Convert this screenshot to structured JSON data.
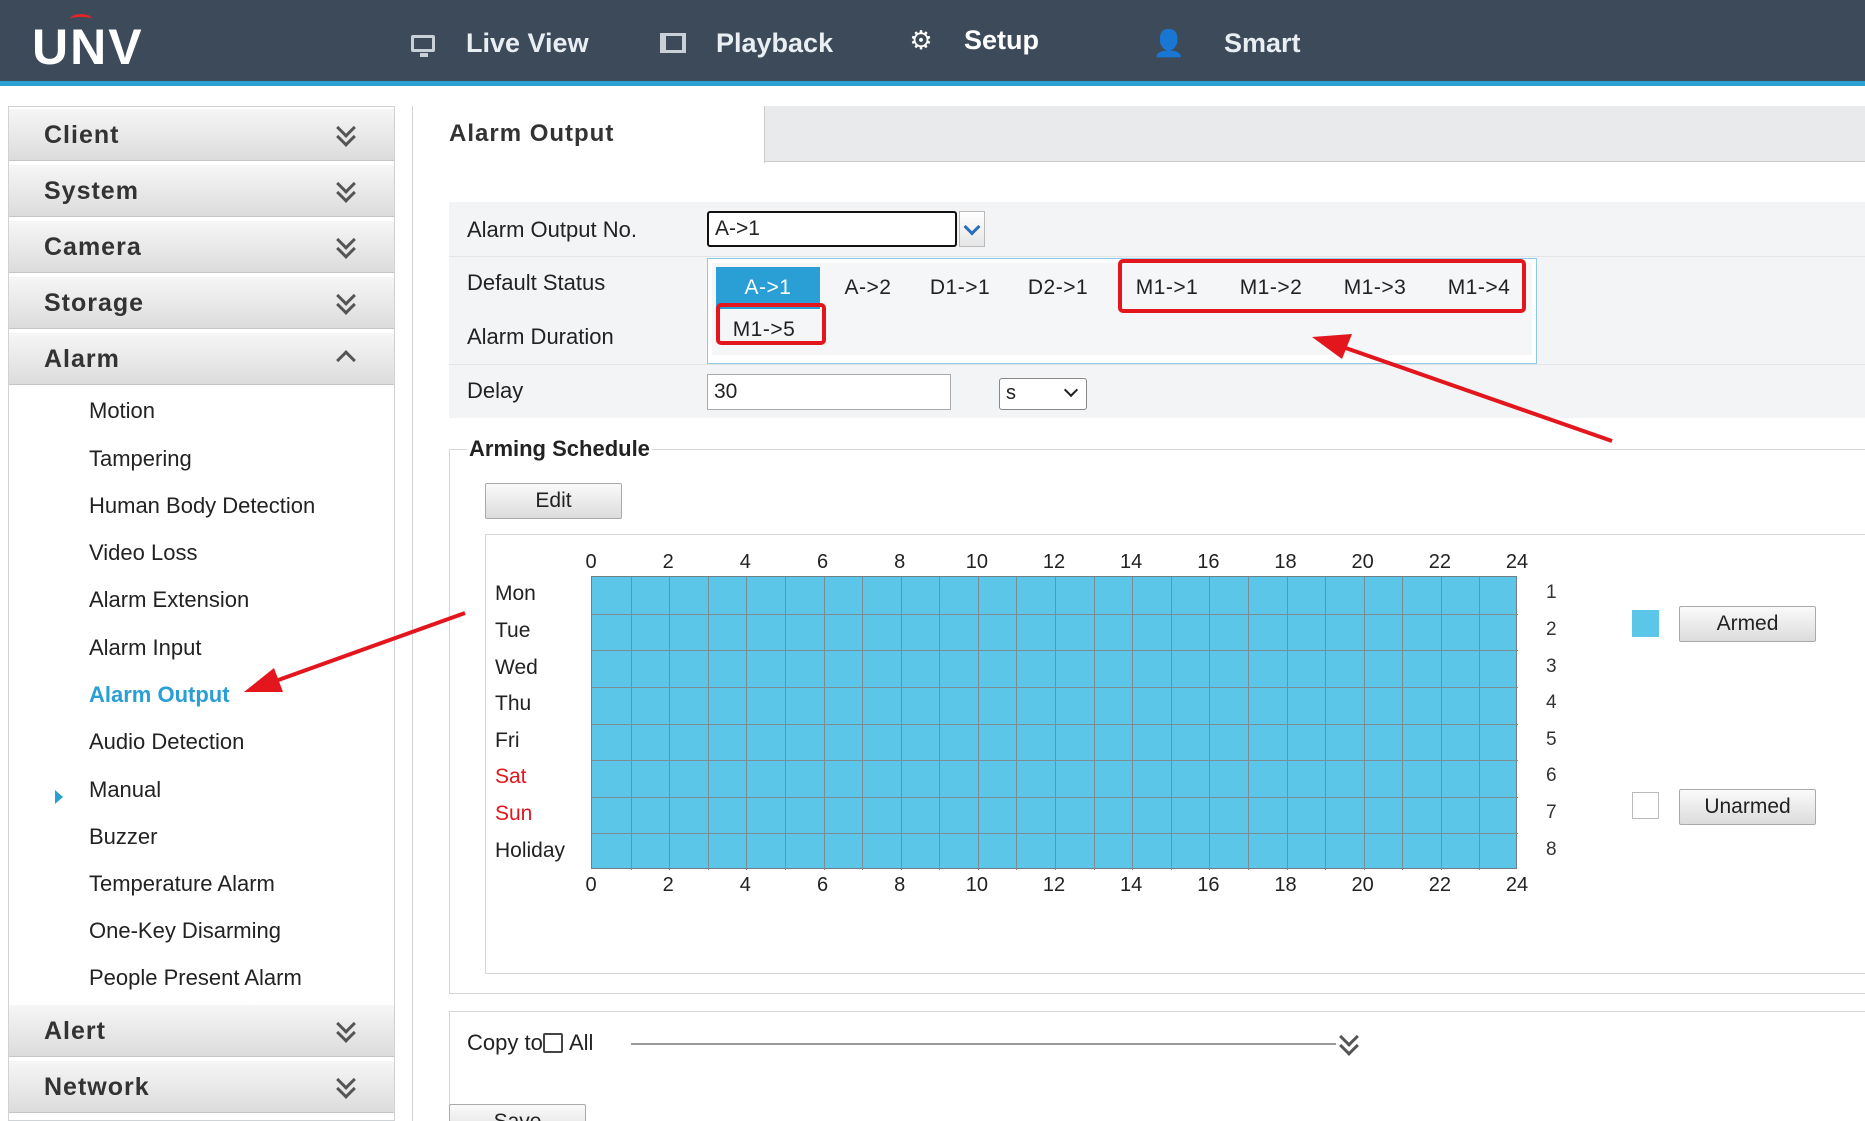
{
  "brand": {
    "logo": "UNV"
  },
  "nav": {
    "items": [
      {
        "label": "Live View",
        "icon": "monitor-icon"
      },
      {
        "label": "Playback",
        "icon": "film-icon"
      },
      {
        "label": "Setup",
        "icon": "gear-icon",
        "active": true
      },
      {
        "label": "Smart",
        "icon": "person-search-icon"
      }
    ]
  },
  "sidebar": {
    "groups": [
      {
        "label": "Client",
        "expanded": false
      },
      {
        "label": "System",
        "expanded": false
      },
      {
        "label": "Camera",
        "expanded": false
      },
      {
        "label": "Storage",
        "expanded": false
      },
      {
        "label": "Alarm",
        "expanded": true
      },
      {
        "label": "Alert",
        "expanded": false
      },
      {
        "label": "Network",
        "expanded": false
      }
    ],
    "alarm_items": [
      "Motion",
      "Tampering",
      "Human Body Detection",
      "Video Loss",
      "Alarm Extension",
      "Alarm Input",
      "Alarm Output",
      "Audio Detection",
      "Manual",
      "Buzzer",
      "Temperature Alarm",
      "One-Key Disarming",
      "People Present Alarm"
    ],
    "active_item": "Alarm Output"
  },
  "page": {
    "tab_title": "Alarm Output"
  },
  "form": {
    "alarm_output_no_label": "Alarm Output No.",
    "alarm_output_no_value": "A->1",
    "default_status_label": "Default Status",
    "alarm_duration_label": "Alarm Duration",
    "delay_label": "Delay",
    "delay_value": "30",
    "delay_unit": "s",
    "dropdown_options": [
      "A->1",
      "A->2",
      "D1->1",
      "D2->1",
      "M1->1",
      "M1->2",
      "M1->3",
      "M1->4",
      "M1->5"
    ],
    "selected_option": "A->1"
  },
  "schedule": {
    "title": "Arming Schedule",
    "edit_label": "Edit",
    "hours": [
      "0",
      "2",
      "4",
      "6",
      "8",
      "10",
      "12",
      "14",
      "16",
      "18",
      "20",
      "22",
      "24"
    ],
    "days": [
      {
        "label": "Mon",
        "num": "1",
        "weekend": false
      },
      {
        "label": "Tue",
        "num": "2",
        "weekend": false
      },
      {
        "label": "Wed",
        "num": "3",
        "weekend": false
      },
      {
        "label": "Thu",
        "num": "4",
        "weekend": false
      },
      {
        "label": "Fri",
        "num": "5",
        "weekend": false
      },
      {
        "label": "Sat",
        "num": "6",
        "weekend": true
      },
      {
        "label": "Sun",
        "num": "7",
        "weekend": true
      },
      {
        "label": "Holiday",
        "num": "8",
        "weekend": false
      }
    ],
    "armed_label": "Armed",
    "unarmed_label": "Unarmed",
    "armed_color": "#5bc6e8",
    "weekend_color": "#e3161d"
  },
  "copy": {
    "label": "Copy to",
    "all_label": "All",
    "all_checked": false
  },
  "save_label": "Save",
  "colors": {
    "accent": "#2a9fd6",
    "topbar": "#3c4a59",
    "annotation": "#e3161d"
  }
}
